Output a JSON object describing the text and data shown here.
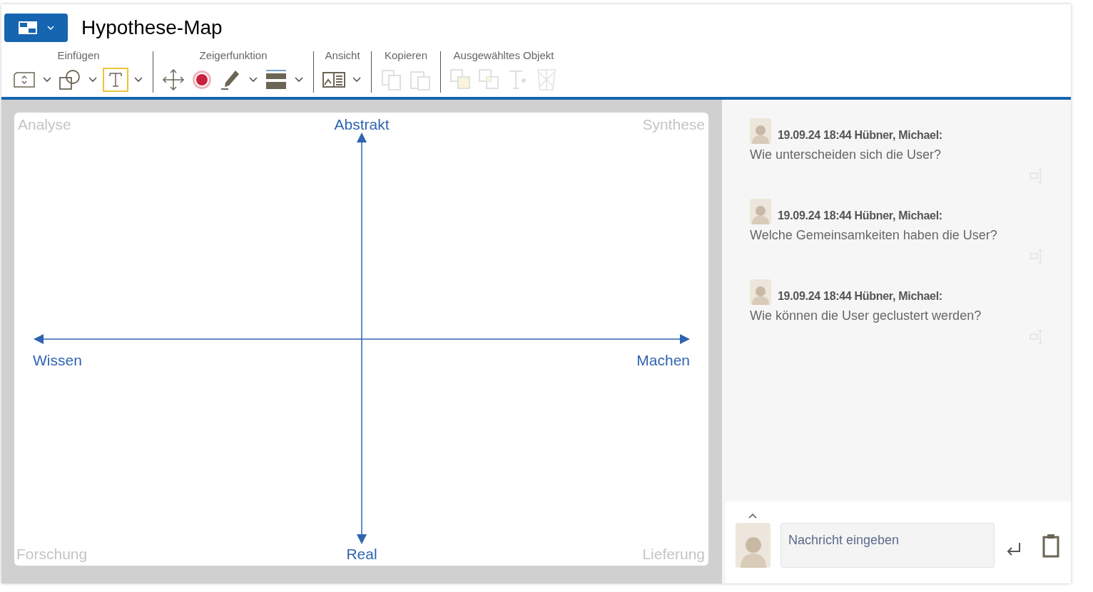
{
  "app_menu": {
    "expanded": false
  },
  "window": {
    "title": "Hypothese-Map"
  },
  "toolbar": [
    {
      "label": "Einfügen",
      "tools": [
        {
          "selected": false,
          "disabled": false,
          "dropdown": true
        },
        {
          "selected": false,
          "disabled": false,
          "dropdown": true
        },
        {
          "selected": true,
          "disabled": false,
          "dropdown": true
        }
      ]
    },
    {
      "label": "Zeigerfunktion",
      "tools": [
        {
          "selected": false,
          "disabled": false,
          "dropdown": false
        },
        {
          "selected": false,
          "disabled": false,
          "dropdown": false
        },
        {
          "selected": false,
          "disabled": false,
          "dropdown": true
        },
        {
          "selected": false,
          "disabled": false,
          "dropdown": true
        }
      ]
    },
    {
      "label": "Ansicht",
      "tools": [
        {
          "selected": false,
          "disabled": false,
          "dropdown": true
        }
      ]
    },
    {
      "label": "Kopieren",
      "tools": [
        {
          "selected": false,
          "disabled": true,
          "dropdown": false
        },
        {
          "selected": false,
          "disabled": true,
          "dropdown": false
        }
      ]
    },
    {
      "label": "Ausgewähltes Objekt",
      "tools": [
        {
          "selected": false,
          "disabled": true,
          "dropdown": false
        },
        {
          "selected": false,
          "disabled": true,
          "dropdown": false
        },
        {
          "selected": false,
          "disabled": true,
          "dropdown": false
        },
        {
          "selected": false,
          "disabled": true,
          "dropdown": false
        }
      ]
    }
  ],
  "board": {
    "corners": {
      "top_left": "Analyse",
      "top_right": "Synthese",
      "bottom_left": "Forschung",
      "bottom_right": "Lieferung"
    },
    "axes": {
      "top": "Abstrakt",
      "bottom": "Real",
      "left": "Wissen",
      "right": "Machen"
    }
  },
  "chat": {
    "messages": [
      {
        "header": "19.09.24 18:44 Hübner, Michael:",
        "text": "Wie unterscheiden sich die User?"
      },
      {
        "header": "19.09.24 18:44 Hübner, Michael:",
        "text": "Welche Gemeinsamkeiten haben die User?"
      },
      {
        "header": "19.09.24 18:44 Hübner, Michael:",
        "text": "Wie können die User geclustert werden?"
      }
    ],
    "input": {
      "placeholder": "Nachricht eingeben"
    }
  }
}
